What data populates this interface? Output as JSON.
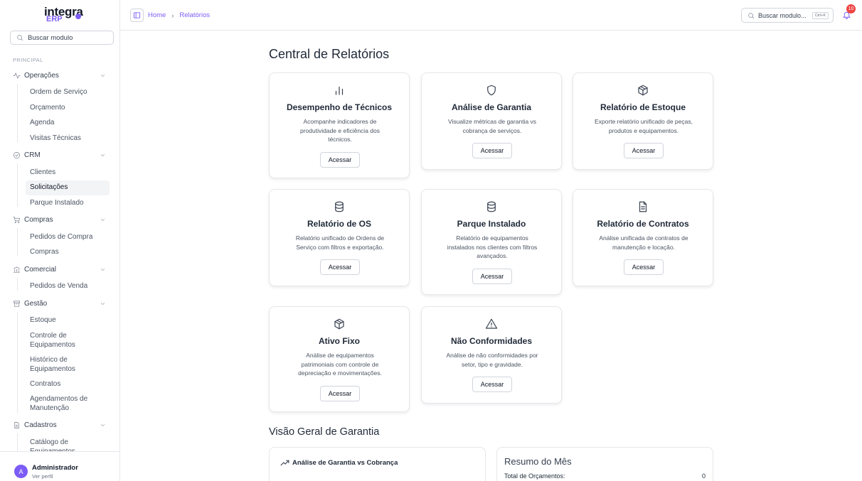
{
  "brand": {
    "name_top": "integra",
    "name_bottom": "ERP",
    "accent": "#7c5cf6"
  },
  "sidebar": {
    "search_placeholder": "Buscar modulo",
    "section_label": "PRINCIPAL",
    "groups": [
      {
        "label": "Operações",
        "icon": "activity-icon",
        "items": [
          "Ordem de Serviço",
          "Orçamento",
          "Agenda",
          "Visitas Técnicas"
        ]
      },
      {
        "label": "CRM",
        "icon": "check-circle-icon",
        "items": [
          "Clientes",
          "Solicitações",
          "Parque Instalado"
        ]
      },
      {
        "label": "Compras",
        "icon": "cart-icon",
        "items": [
          "Pedidos de Compra",
          "Compras"
        ]
      },
      {
        "label": "Comercial",
        "icon": "bank-icon",
        "items": [
          "Pedidos de Venda"
        ]
      },
      {
        "label": "Gestão",
        "icon": "archive-icon",
        "items": [
          "Estoque",
          "Controle de Equipamentos",
          "Histórico de Equipamentos",
          "Contratos",
          "Agendamentos de Manutenção"
        ]
      },
      {
        "label": "Cadastros",
        "icon": "file-icon",
        "items": [
          "Catálogo de Equipamentos"
        ]
      }
    ],
    "active_item": "Solicitações",
    "user": {
      "initial": "A",
      "name": "Administrador",
      "subtitle": "Ver perfil"
    }
  },
  "topbar": {
    "breadcrumb": [
      "Home",
      "Relatórios"
    ],
    "search_placeholder": "Buscar modulo...",
    "shortcut": "Ctrl+K",
    "notification_count": "10"
  },
  "main": {
    "title": "Central de Relatórios",
    "cards": [
      {
        "title": "Desempenho de Técnicos",
        "description": "Acompanhe indicadores de produtividade e eficiência dos técnicos.",
        "button": "Acessar",
        "icon": "bar-chart-icon"
      },
      {
        "title": "Análise de Garantia",
        "description": "Visualize métricas de garantia vs cobrança de serviços.",
        "button": "Acessar",
        "icon": "shield-icon"
      },
      {
        "title": "Relatório de Estoque",
        "description": "Exporte relatório unificado de peças, produtos e equipamentos.",
        "button": "Acessar",
        "icon": "package-icon"
      },
      {
        "title": "Relatório de OS",
        "description": "Relatório unificado de Ordens de Serviço com filtros e exportação.",
        "button": "Acessar",
        "icon": "database-icon"
      },
      {
        "title": "Parque Instalado",
        "description": "Relatório de equipamentos instalados nos clientes com filtros avançados.",
        "button": "Acessar",
        "icon": "database-icon"
      },
      {
        "title": "Relatório de Contratos",
        "description": "Análise unificada de contratos de manutenção e locação.",
        "button": "Acessar",
        "icon": "document-icon"
      },
      {
        "title": "Ativo Fixo",
        "description": "Análise de equipamentos patrimoniais com controle de depreciação e movimentações.",
        "button": "Acessar",
        "icon": "package-icon"
      },
      {
        "title": "Não Conformidades",
        "description": "Análise de não conformidades por setor, tipo e gravidade.",
        "button": "Acessar",
        "icon": "warning-icon"
      }
    ],
    "overview_title": "Visão Geral de Garantia",
    "chart_panel_title": "Análise de Garantia vs Cobrança",
    "summary": {
      "title": "Resumo do Mês",
      "rows": [
        {
          "label": "Total de Orçamentos:",
          "value": "0"
        }
      ]
    }
  }
}
